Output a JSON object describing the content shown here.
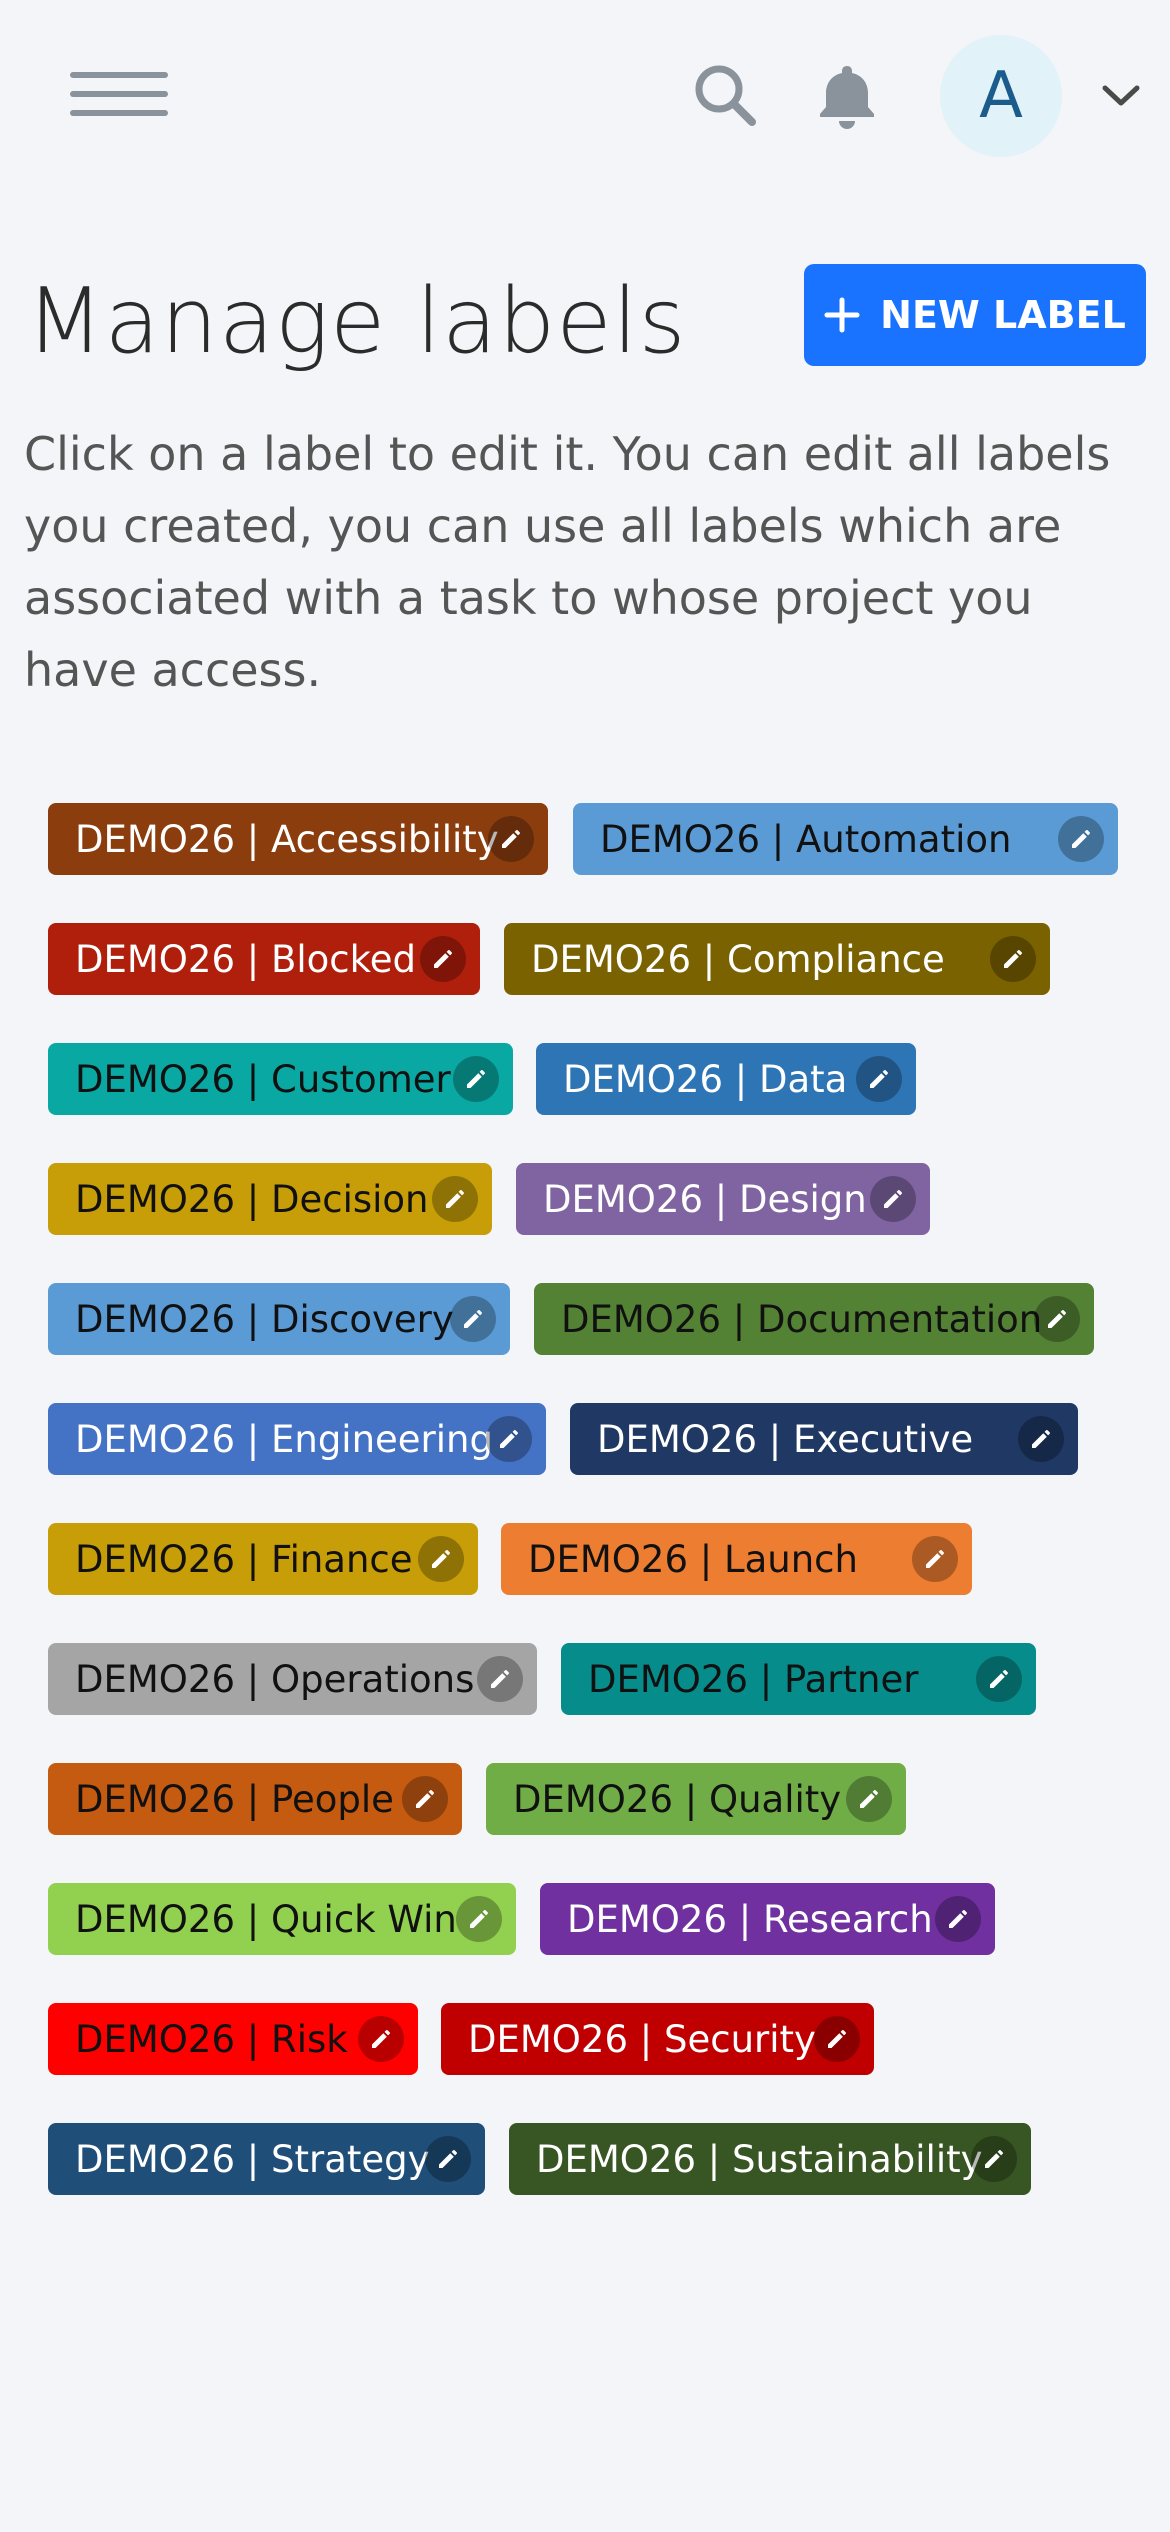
{
  "header": {
    "avatar_initial": "A"
  },
  "page": {
    "title": "Manage labels",
    "new_label_button": "NEW LABEL",
    "description": "Click on a label to edit it. You can edit all labels you created, you can use all labels which are associated with a task to whose project you have access."
  },
  "labels": [
    {
      "text": "DEMO26 | Accessibility",
      "bg": "#8b3d0e",
      "fg": "#ffffff"
    },
    {
      "text": "DEMO26 | Automation",
      "bg": "#5b9bd5",
      "fg": "#111111"
    },
    {
      "text": "DEMO26 | Blocked",
      "bg": "#b01e0c",
      "fg": "#ffffff"
    },
    {
      "text": "DEMO26 | Compliance",
      "bg": "#7a6200",
      "fg": "#ffffff"
    },
    {
      "text": "DEMO26 | Customer",
      "bg": "#0aa8a3",
      "fg": "#111111"
    },
    {
      "text": "DEMO26 | Data",
      "bg": "#2e75b6",
      "fg": "#ffffff"
    },
    {
      "text": "DEMO26 | Decision",
      "bg": "#c79e08",
      "fg": "#111111"
    },
    {
      "text": "DEMO26 | Design",
      "bg": "#8064a2",
      "fg": "#ffffff"
    },
    {
      "text": "DEMO26 | Discovery",
      "bg": "#5b9bd5",
      "fg": "#111111"
    },
    {
      "text": "DEMO26 | Documentation",
      "bg": "#548235",
      "fg": "#111111"
    },
    {
      "text": "DEMO26 | Engineering",
      "bg": "#4472c4",
      "fg": "#ffffff"
    },
    {
      "text": "DEMO26 | Executive",
      "bg": "#1f3864",
      "fg": "#ffffff"
    },
    {
      "text": "DEMO26 | Finance",
      "bg": "#c79e08",
      "fg": "#111111"
    },
    {
      "text": "DEMO26 | Launch",
      "bg": "#ed7d31",
      "fg": "#111111"
    },
    {
      "text": "DEMO26 | Operations",
      "bg": "#a5a5a5",
      "fg": "#111111"
    },
    {
      "text": "DEMO26 | Partner",
      "bg": "#078c8c",
      "fg": "#111111"
    },
    {
      "text": "DEMO26 | People",
      "bg": "#c55a11",
      "fg": "#111111"
    },
    {
      "text": "DEMO26 | Quality",
      "bg": "#70ad47",
      "fg": "#111111"
    },
    {
      "text": "DEMO26 | Quick Win",
      "bg": "#92d050",
      "fg": "#111111"
    },
    {
      "text": "DEMO26 | Research",
      "bg": "#7030a0",
      "fg": "#ffffff"
    },
    {
      "text": "DEMO26 | Risk",
      "bg": "#ff0000",
      "fg": "#111111"
    },
    {
      "text": "DEMO26 | Security",
      "bg": "#c00000",
      "fg": "#ffffff"
    },
    {
      "text": "DEMO26 | Strategy",
      "bg": "#1f4e79",
      "fg": "#ffffff"
    },
    {
      "text": "DEMO26 | Sustainability",
      "bg": "#375623",
      "fg": "#ffffff"
    }
  ]
}
